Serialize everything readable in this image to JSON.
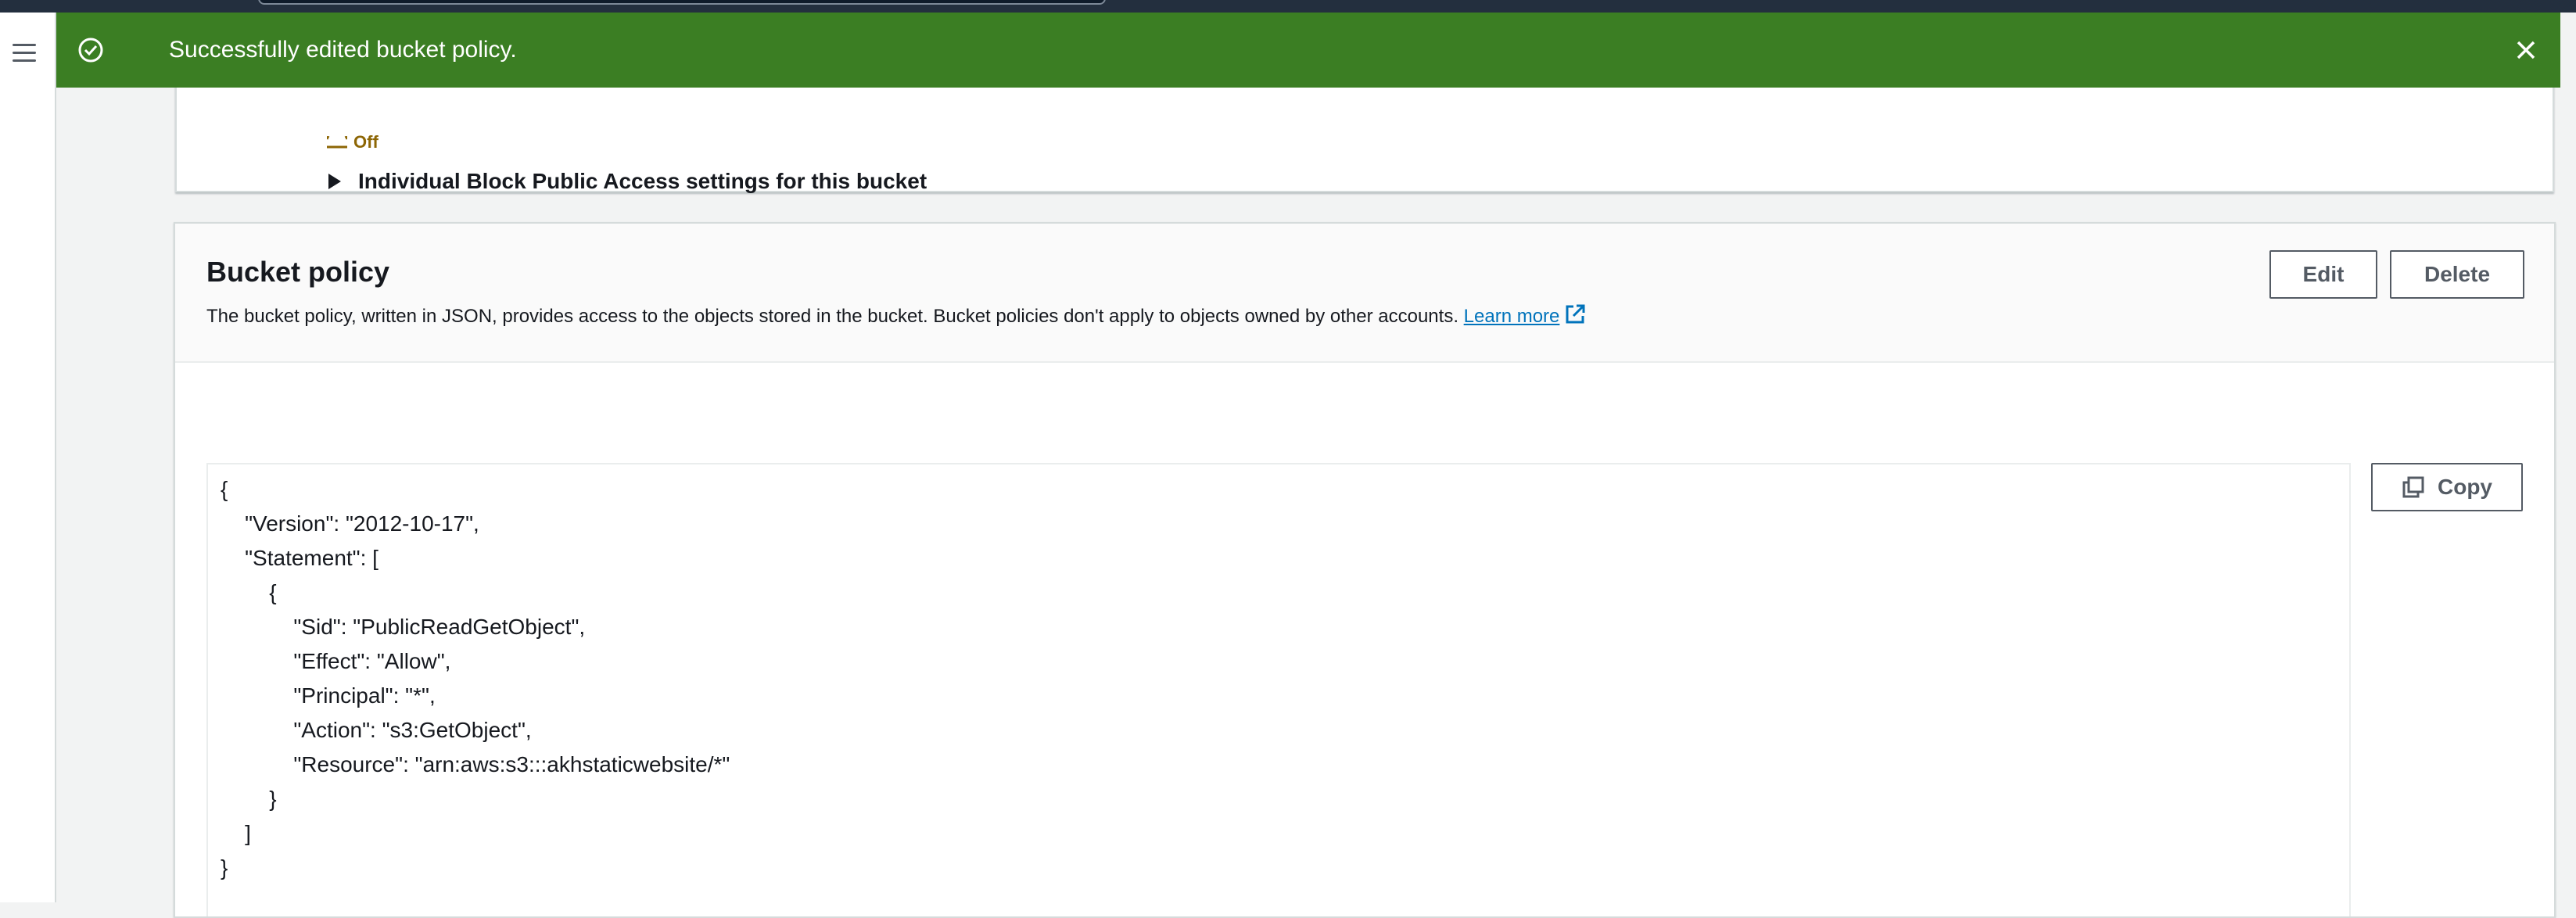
{
  "flash": {
    "message": "Successfully edited bucket policy.",
    "close_icon": "close-icon",
    "status_icon": "check-circle-icon",
    "color": "#3b7e23"
  },
  "block_public_access": {
    "status_text": "Off",
    "expander_label": "Individual Block Public Access settings for this bucket"
  },
  "bucket_policy": {
    "title": "Bucket policy",
    "description": "The bucket policy, written in JSON, provides access to the objects stored in the bucket. Bucket policies don't apply to objects owned by other accounts.",
    "learn_more": "Learn more",
    "edit_label": "Edit",
    "delete_label": "Delete",
    "copy_label": "Copy",
    "policy_lines": [
      "{",
      "    \"Version\": \"2012-10-17\",",
      "    \"Statement\": [",
      "        {",
      "            \"Sid\": \"PublicReadGetObject\",",
      "            \"Effect\": \"Allow\",",
      "            \"Principal\": \"*\",",
      "            \"Action\": \"s3:GetObject\",",
      "            \"Resource\": \"arn:aws:s3:::akhstaticwebsite/*\"",
      "        }",
      "    ]",
      "}"
    ]
  },
  "colors": {
    "link": "#0073bb",
    "topbar": "#232f3e",
    "warning": "#8d6605"
  }
}
